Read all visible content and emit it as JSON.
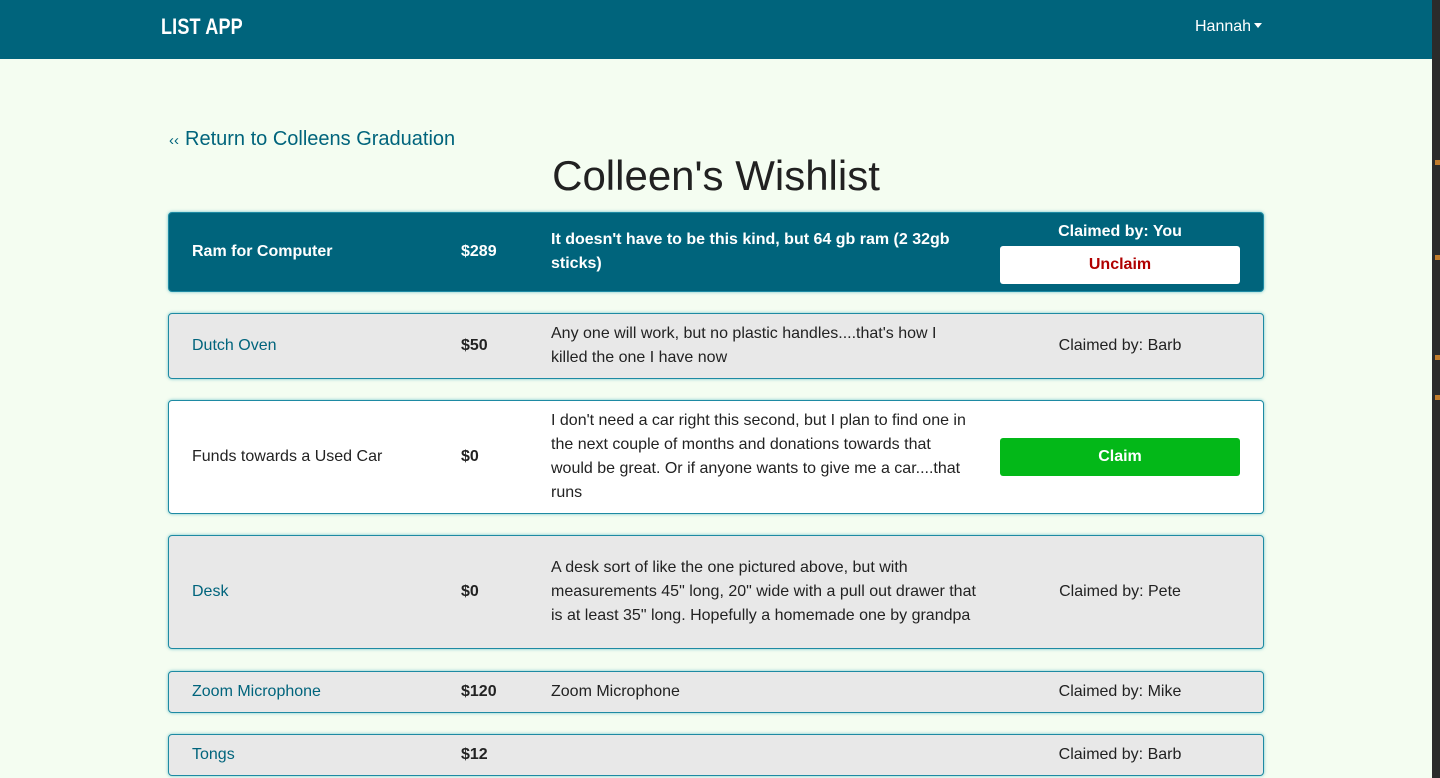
{
  "navbar": {
    "brand": "LIST APP",
    "user": "Hannah"
  },
  "back_link": {
    "chevron": "‹‹",
    "label": "Return to Colleens Graduation"
  },
  "page_title": "Colleen's Wishlist",
  "items": [
    {
      "name": "Ram for Computer",
      "price": "$289",
      "description": "It doesn't have to be this kind, but 64 gb ram (2 32gb sticks)",
      "claimed_by": "Claimed by: You",
      "action_label": "Unclaim",
      "state": "claimed-by-you"
    },
    {
      "name": "Dutch Oven",
      "price": "$50",
      "description": "Any one will work, but no plastic handles....that's how I killed the one I have now",
      "claimed_by": "Claimed by: Barb",
      "state": "claimed"
    },
    {
      "name": "Funds towards a Used Car",
      "price": "$0",
      "description": "I don't need a car right this second, but I plan to find one in the next couple of months and donations towards that would be great. Or if anyone wants to give me a car....that runs",
      "action_label": "Claim",
      "state": "unclaimed"
    },
    {
      "name": "Desk",
      "price": "$0",
      "description": "A desk sort of like the one pictured above, but with measurements 45\" long, 20\" wide with a pull out drawer that is at least 35\" long. Hopefully a homemade one by grandpa",
      "claimed_by": "Claimed by: Pete",
      "state": "claimed"
    },
    {
      "name": "Zoom Microphone",
      "price": "$120",
      "description": "Zoom Microphone",
      "claimed_by": "Claimed by: Mike",
      "state": "claimed"
    },
    {
      "name": "Tongs",
      "price": "$12",
      "description": "",
      "claimed_by": "Claimed by: Barb",
      "state": "claimed"
    }
  ],
  "colors": {
    "navbar": "#00647c",
    "page_background": "#f4fdf1",
    "claim_button": "#03b818",
    "unclaim_text": "#b00000",
    "claimed_row": "#e8e8e8"
  }
}
